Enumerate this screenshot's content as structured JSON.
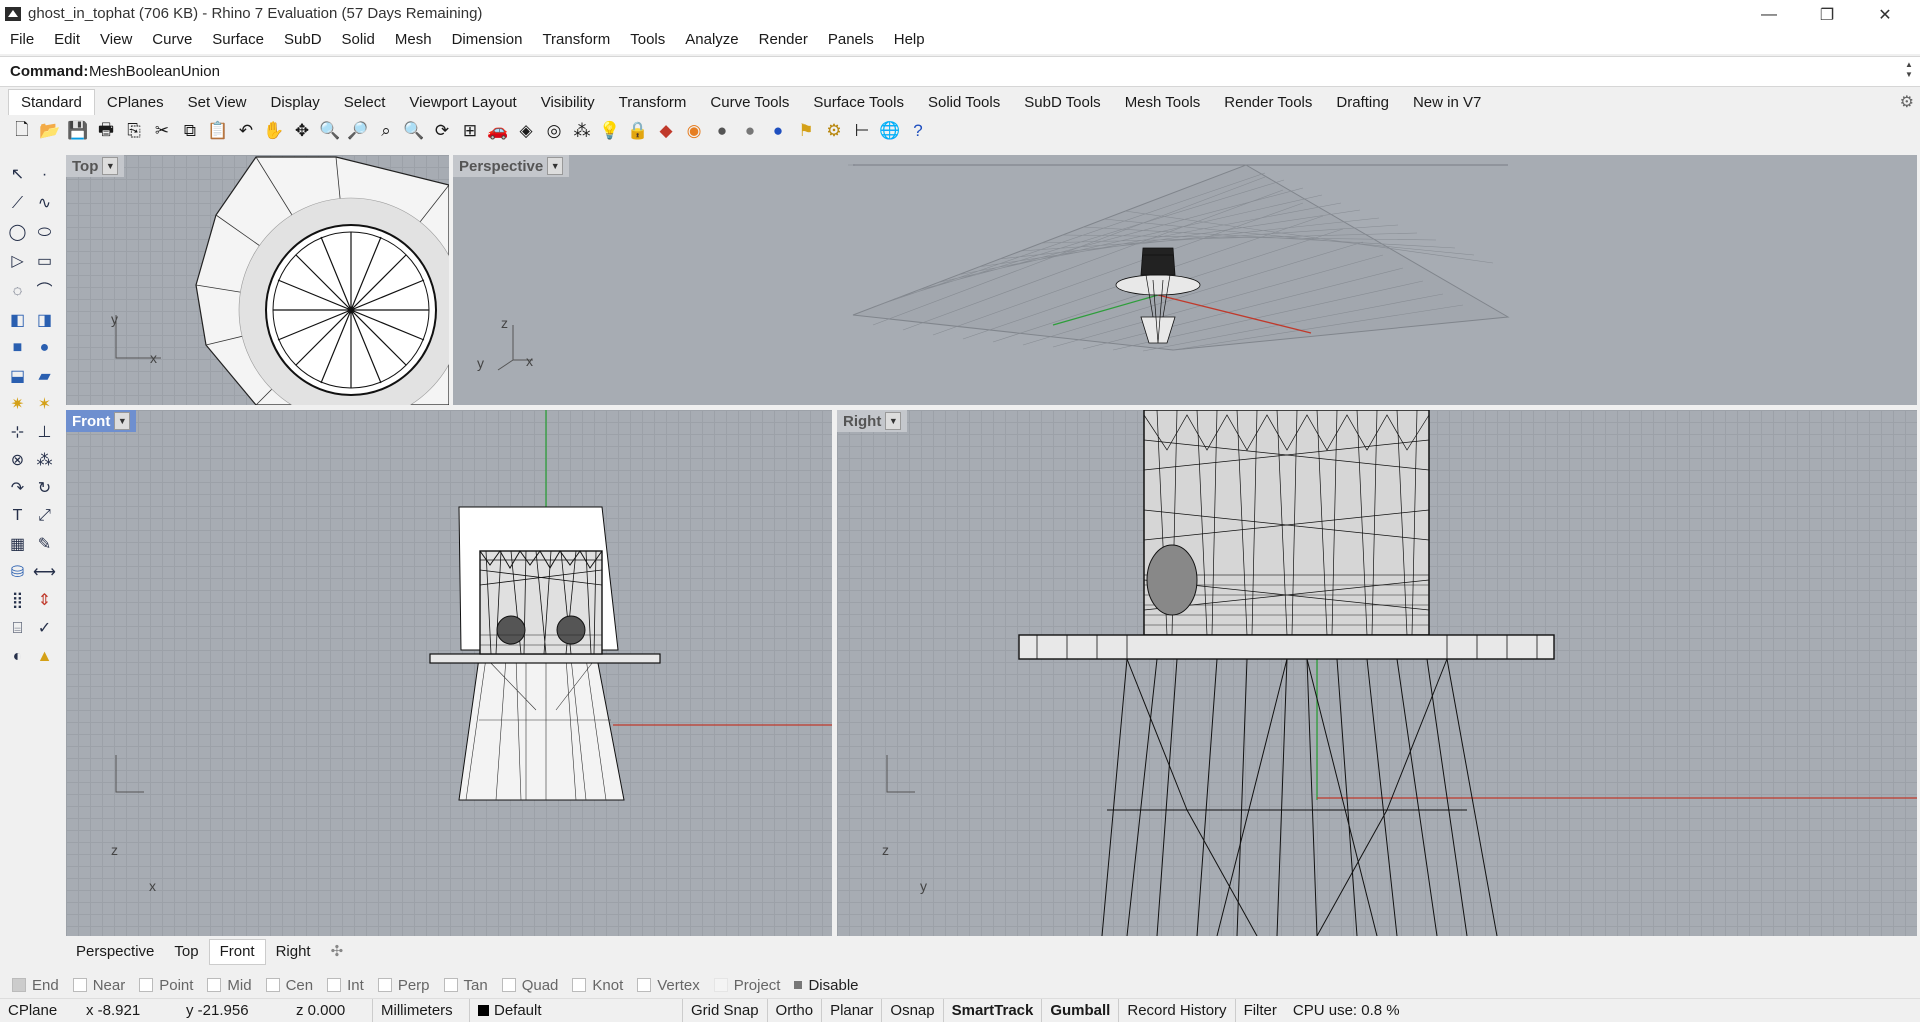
{
  "window": {
    "title": "ghost_in_tophat (706 KB) - Rhino 7 Evaluation (57 Days Remaining)"
  },
  "menu": [
    "File",
    "Edit",
    "View",
    "Curve",
    "Surface",
    "SubD",
    "Solid",
    "Mesh",
    "Dimension",
    "Transform",
    "Tools",
    "Analyze",
    "Render",
    "Panels",
    "Help"
  ],
  "command": {
    "prompt": "Command:",
    "value": "MeshBooleanUnion"
  },
  "tabs": [
    "Standard",
    "CPlanes",
    "Set View",
    "Display",
    "Select",
    "Viewport Layout",
    "Visibility",
    "Transform",
    "Curve Tools",
    "Surface Tools",
    "Solid Tools",
    "SubD Tools",
    "Mesh Tools",
    "Render Tools",
    "Drafting",
    "New in V7"
  ],
  "toolbar_icons": [
    "new-icon",
    "open-icon",
    "save-icon",
    "print-icon",
    "import-icon",
    "cut-icon",
    "copy-icon",
    "paste-icon",
    "undo-icon",
    "pan-icon",
    "rotate-icon",
    "zoom-icon",
    "zoom-window-icon",
    "zoom-extents-icon",
    "zoom-selected-icon",
    "rotate-view-icon",
    "four-view-icon",
    "car-icon",
    "object-icon",
    "circle-icon",
    "snap-icon",
    "light-icon",
    "lock-icon",
    "material-icon",
    "color-wheel-icon",
    "sphere-icon",
    "render-sphere-icon",
    "blue-sphere-icon",
    "flag-icon",
    "gear-icon",
    "tree-icon",
    "globe-icon",
    "help-icon"
  ],
  "viewports": {
    "top": {
      "label": "Top",
      "axis_a": "y",
      "axis_b": "x"
    },
    "perspective": {
      "label": "Perspective",
      "axis_a": "z",
      "axis_b": "x",
      "axis_c": "y"
    },
    "front": {
      "label": "Front",
      "axis_a": "z",
      "axis_b": "x"
    },
    "right": {
      "label": "Right",
      "axis_a": "z",
      "axis_b": "y"
    }
  },
  "viewport_tabs": [
    "Perspective",
    "Top",
    "Front",
    "Right"
  ],
  "viewport_tabs_active": "Front",
  "osnaps": [
    {
      "label": "End",
      "checked": true
    },
    {
      "label": "Near",
      "checked": false
    },
    {
      "label": "Point",
      "checked": false
    },
    {
      "label": "Mid",
      "checked": false
    },
    {
      "label": "Cen",
      "checked": false
    },
    {
      "label": "Int",
      "checked": false
    },
    {
      "label": "Perp",
      "checked": false
    },
    {
      "label": "Tan",
      "checked": false
    },
    {
      "label": "Quad",
      "checked": false
    },
    {
      "label": "Knot",
      "checked": false
    },
    {
      "label": "Vertex",
      "checked": false
    },
    {
      "label": "Project",
      "checked": false
    },
    {
      "label": "Disable",
      "checked": false
    }
  ],
  "status": {
    "cplane": "CPlane",
    "x": "x -8.921",
    "y": "y -21.956",
    "z": "z 0.000",
    "units": "Millimeters",
    "layer": "Default",
    "grid_snap": "Grid Snap",
    "ortho": "Ortho",
    "planar": "Planar",
    "osnap": "Osnap",
    "smarttrack": "SmartTrack",
    "gumball": "Gumball",
    "record_history": "Record History",
    "filter": "Filter",
    "cpu": "CPU use: 0.8 %"
  },
  "colors": {
    "active_viewport": "#6e8fcf",
    "viewport_bg": "#a7acb3",
    "x_axis": "#c0392b",
    "y_axis": "#2e9e3b"
  }
}
